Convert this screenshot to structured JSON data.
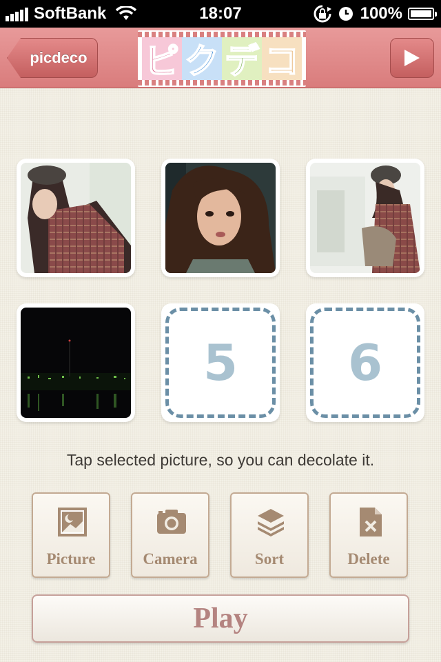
{
  "status_bar": {
    "carrier": "SoftBank",
    "time": "18:07",
    "battery": "100%"
  },
  "nav": {
    "back_label": "picdeco",
    "logo_chars": [
      "ピ",
      "ク",
      "デ",
      "コ"
    ],
    "logo_colors": [
      "#d64a7a",
      "#3a8ad6",
      "#6aa83a",
      "#d98a2a"
    ],
    "tile_colors": [
      "#f7c8d8",
      "#c8e0f7",
      "#e0f0c0",
      "#f7e0c0"
    ]
  },
  "slots": [
    {
      "slot": "1",
      "filled": true
    },
    {
      "slot": "2",
      "filled": true
    },
    {
      "slot": "3",
      "filled": true
    },
    {
      "slot": "4",
      "filled": true
    },
    {
      "slot": "5",
      "filled": false,
      "number": "5"
    },
    {
      "slot": "6",
      "filled": false,
      "number": "6"
    }
  ],
  "hint_text": "Tap selected picture, so you can decolate it.",
  "toolbar": {
    "picture_label": "Picture",
    "camera_label": "Camera",
    "sort_label": "Sort",
    "delete_label": "Delete"
  },
  "play_label": "Play",
  "colors": {
    "nav_pink": "#d97c7c",
    "button_text": "#a58a72",
    "play_text": "#b48380",
    "slot_dash": "#6b8fa6",
    "slot_number": "#a9c2d0"
  }
}
